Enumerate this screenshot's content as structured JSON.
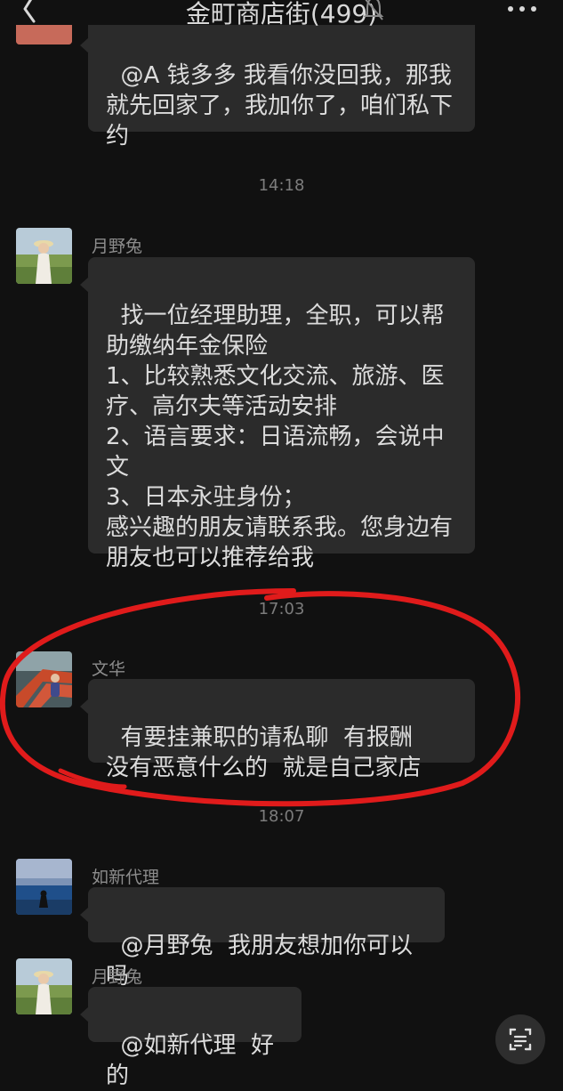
{
  "header": {
    "title": "金町商店街(499)",
    "back_icon": "chevron-left-icon",
    "mute_icon": "bell-off-icon",
    "more_icon": "more-horizontal-icon"
  },
  "messages": [
    {
      "sender": "",
      "text": "@A 钱多多 我看你没回我，那我就先回家了，我加你了，咱们私下约"
    },
    {
      "sender": "月野兔",
      "text": "找一位经理助理，全职，可以帮助缴纳年金保险\n1、比较熟悉文化交流、旅游、医疗、高尔夫等活动安排\n2、语言要求：日语流畅，会说中文\n3、日本永驻身份；\n感兴趣的朋友请联系我。您身边有朋友也可以推荐给我"
    },
    {
      "sender": "文华",
      "text": "有要挂兼职的请私聊  有报酬    没有恶意什么的  就是自己家店"
    },
    {
      "sender": "如新代理",
      "text": "@月野兔  我朋友想加你可以吗"
    },
    {
      "sender": "月野兔",
      "text": "@如新代理  好的"
    }
  ],
  "timestamps": [
    "14:18",
    "17:03",
    "18:07"
  ],
  "scan_icon": "scan-text-icon",
  "colors": {
    "background": "#111111",
    "bubble": "#2b2b2b",
    "annotation": "#e01b1b"
  }
}
